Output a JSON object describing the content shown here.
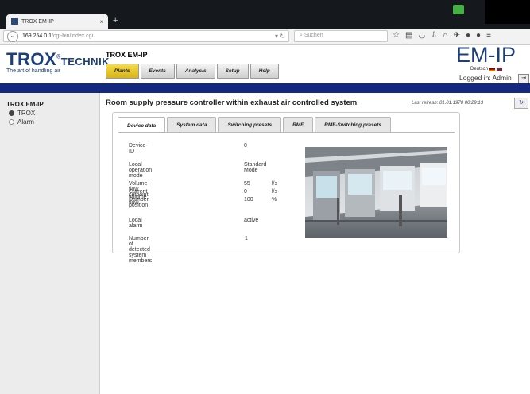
{
  "browser": {
    "tab_title": "TROX EM-IP",
    "url_host": "169.254.0.1",
    "url_path": "/cgi-bin/index.cgi",
    "search_placeholder": "Suchen"
  },
  "header": {
    "logo_text": "TROX",
    "logo_suffix": "TECHNIK",
    "logo_reg": "®",
    "tagline": "The art of handling air",
    "app_title": "TROX EM-IP",
    "product": "EM-IP",
    "language": "Deutsch",
    "logged_in": "Logged in: Admin"
  },
  "menu": [
    "Plants",
    "Events",
    "Analysis",
    "Setup",
    "Help"
  ],
  "sidebar": {
    "title": "TROX EM-IP",
    "items": [
      "TROX",
      "Alarm"
    ],
    "selected": "TROX"
  },
  "main": {
    "heading": "Room supply pressure controller within exhaust air controlled system",
    "last_refresh": "Last refresh: 01.01.1970 00:29:13",
    "tabs": [
      "Device data",
      "System data",
      "Switching presets",
      "RMF",
      "RMF-Switching presets"
    ],
    "active_tab": "Device data"
  },
  "device": {
    "device_id_label": "Device-ID",
    "device_id": "0",
    "mode_label": "Local operation mode",
    "mode": "Standard Mode",
    "setpoint_label": "Volume flow setpoint",
    "setpoint": "55",
    "setpoint_unit": "l/s",
    "current_label": "Current volume flow",
    "current": "0",
    "current_unit": "l/s",
    "damper_label": "Damper position",
    "damper": "100",
    "damper_unit": "%",
    "alarm_label": "Local alarm",
    "alarm": "active",
    "members_label": "Number of detected system members",
    "members": "1"
  },
  "colors": {
    "brand_blue": "#1d3f7c",
    "nav_bar": "#15287f",
    "active_menu": "#f0d030"
  }
}
